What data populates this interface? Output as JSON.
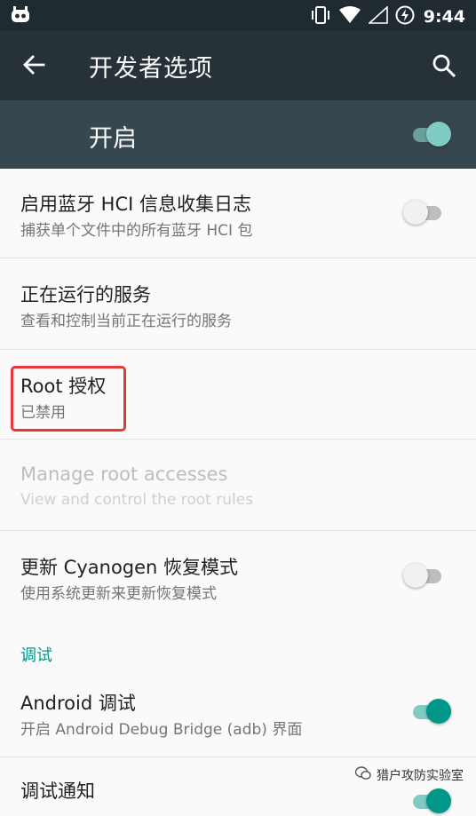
{
  "status_bar": {
    "time": "9:44",
    "icons": [
      "cyanogen-icon",
      "vibrate-icon",
      "wifi-icon",
      "signal-icon",
      "battery-charging-icon"
    ]
  },
  "toolbar": {
    "title": "开发者选项",
    "back_icon": "arrow-back-icon",
    "search_icon": "search-icon"
  },
  "master_switch": {
    "label": "开启",
    "state": "on"
  },
  "settings": [
    {
      "title": "启用蓝牙 HCI 信息收集日志",
      "summary": "捕获单个文件中的所有蓝牙 HCI 包",
      "switch": "off"
    },
    {
      "title": "正在运行的服务",
      "summary": "查看和控制当前正在运行的服务"
    },
    {
      "title": "Root 授权",
      "summary": "已禁用"
    },
    {
      "title": "Manage root accesses",
      "summary": "View and control the root rules",
      "disabled": true
    },
    {
      "title": "更新 Cyanogen 恢复模式",
      "summary": "使用系统更新来更新恢复模式",
      "switch": "off"
    }
  ],
  "debug_section": {
    "header": "调试",
    "items": [
      {
        "title": "Android 调试",
        "summary": "开启 Android Debug Bridge (adb) 界面",
        "switch": "on"
      },
      {
        "title": "调试通知",
        "switch": "on"
      }
    ]
  },
  "watermark": {
    "text": "猎户攻防实验室"
  },
  "colors": {
    "status_bar": "#1f2b30",
    "toolbar": "#263238",
    "master_bar": "#37474f",
    "accent": "#009688",
    "highlight": "#e53935"
  }
}
